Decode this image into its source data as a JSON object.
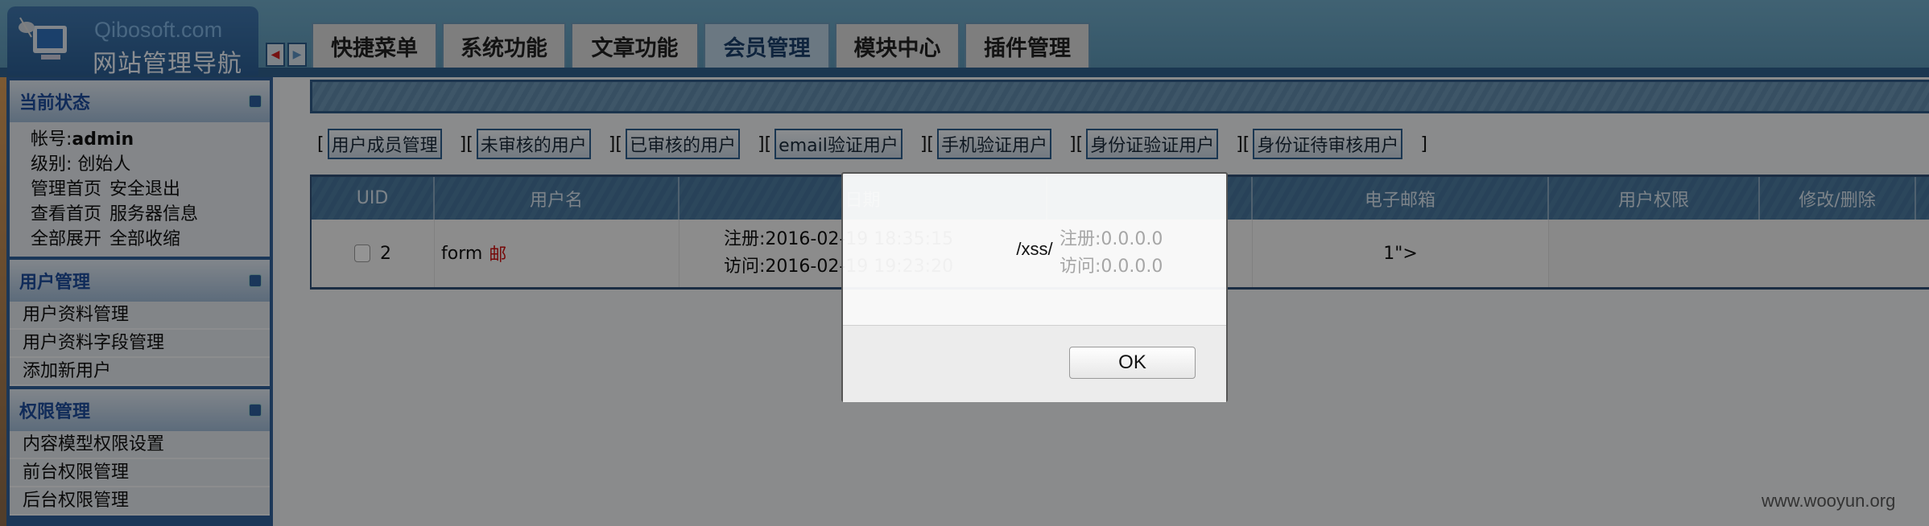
{
  "logo": {
    "brand": "Qibosoft.com",
    "title": "网站管理导航"
  },
  "nav_arrows": {
    "prev": "◀",
    "next": "▶"
  },
  "tabs": [
    {
      "label": "快捷菜单",
      "active": false
    },
    {
      "label": "系统功能",
      "active": false
    },
    {
      "label": "文章功能",
      "active": false
    },
    {
      "label": "会员管理",
      "active": true
    },
    {
      "label": "模块中心",
      "active": false
    },
    {
      "label": "插件管理",
      "active": false
    }
  ],
  "sidebar": {
    "status": {
      "title": "当前状态",
      "account_label": "帐号:",
      "account": "admin",
      "level": "级别: 创始人",
      "links": [
        "管理首页",
        "安全退出",
        "查看首页",
        "服务器信息",
        "全部展开",
        "全部收缩"
      ]
    },
    "sections": [
      {
        "title": "用户管理",
        "items": [
          "用户资料管理",
          "用户资料字段管理",
          "添加新用户"
        ]
      },
      {
        "title": "权限管理",
        "items": [
          "内容模型权限设置",
          "前台权限管理",
          "后台权限管理"
        ]
      }
    ]
  },
  "filters": [
    "用户成员管理",
    "未审核的用户",
    "已审核的用户",
    "email验证用户",
    "手机验证用户",
    "身份证验证用户",
    "身份证待审核用户"
  ],
  "table": {
    "headers": [
      "UID",
      "用户名",
      "日期",
      "",
      "电子邮箱",
      "用户权限",
      "修改/删除",
      ""
    ],
    "rows": [
      {
        "uid": "2",
        "username": "form",
        "username_tag": "邮",
        "date_reg": "注册:2016-02-19 18:35:15",
        "date_visit": "访问:2016-02-19 19:23:20",
        "ip_reg": "注册:0.0.0.0",
        "ip_visit": "访问:0.0.0.0",
        "email": "1\">"
      }
    ]
  },
  "dialog": {
    "message": "/xss/",
    "ok_label": "OK"
  },
  "watermark": "www.wooyun.org",
  "colors": {
    "accent": "#2f5f98",
    "tag_red": "#cc1111"
  }
}
